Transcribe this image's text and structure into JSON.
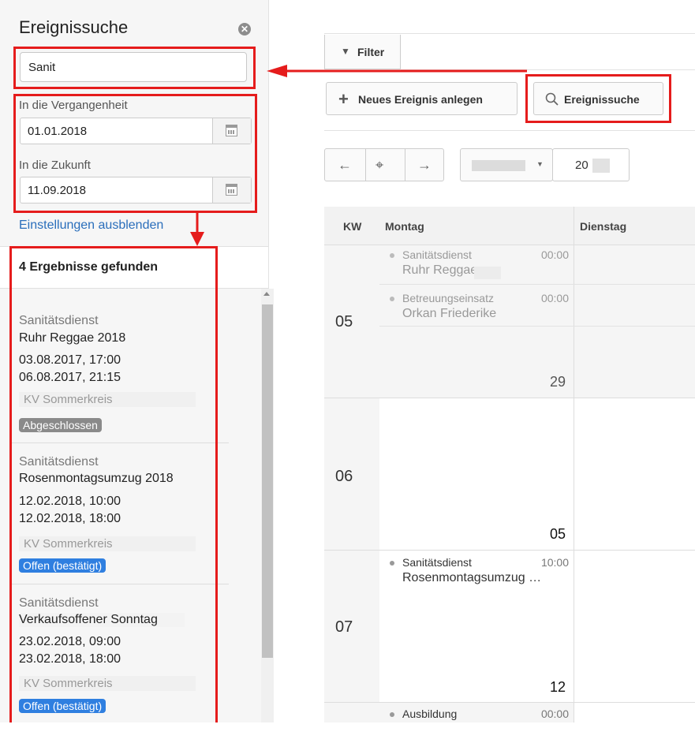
{
  "sidebar": {
    "title": "Ereignissuche",
    "search": {
      "value": "Sanit",
      "placeholder": ""
    },
    "past_label": "In die Vergangenheit",
    "past_date": "01.01.2018",
    "future_label": "In die Zukunft",
    "future_date": "11.09.2018",
    "settings_link": "Einstellungen ausblenden",
    "results_count": "4 Ergebnisse gefunden",
    "results": [
      {
        "category": "Sanitätsdienst",
        "name": "Ruhr Reggae 2018",
        "start": "03.08.2017, 17:00",
        "end": "06.08.2017, 21:15",
        "org": "KV Sommerkreis",
        "status": "Abgeschlossen",
        "status_color": "#8a8a8a"
      },
      {
        "category": "Sanitätsdienst",
        "name": "Rosenmontagsumzug 2018",
        "start": "12.02.2018, 10:00",
        "end": "12.02.2018, 18:00",
        "org": "KV Sommerkreis",
        "status": "Offen (bestätigt)",
        "status_color": "#2f7fe0"
      },
      {
        "category": "Sanitätsdienst",
        "name": "Verkaufsoffener Sonntag",
        "start": "23.02.2018, 09:00",
        "end": "23.02.2018, 18:00",
        "org": "KV Sommerkreis",
        "status": "Offen (bestätigt)",
        "status_color": "#2f7fe0"
      }
    ]
  },
  "toolbar": {
    "filter_label": "Filter",
    "new_event_label": "Neues Ereignis anlegen",
    "search_label": "Ereignissuche",
    "year_prefix": "20"
  },
  "calendar": {
    "col_kw": "KW",
    "col_mon": "Montag",
    "col_tue": "Dienstag",
    "weeks": [
      {
        "kw": "05",
        "day_number": "29"
      },
      {
        "kw": "06",
        "day_number": "05"
      },
      {
        "kw": "07",
        "day_number": "12"
      }
    ],
    "events": [
      {
        "title": "Sanitätsdienst",
        "time": "00:00",
        "subtitle": "Ruhr Reggae"
      },
      {
        "title": "Betreuungseinsatz",
        "time": "00:00",
        "subtitle": "Orkan Friederike"
      },
      {
        "title": "Sanitätsdienst",
        "time": "10:00",
        "subtitle": "Rosenmontagsumzug …"
      },
      {
        "title": "Ausbildung",
        "time": "00:00",
        "subtitle": ""
      }
    ]
  },
  "colors": {
    "highlight": "#e51c1c",
    "link": "#2a6ebb"
  }
}
